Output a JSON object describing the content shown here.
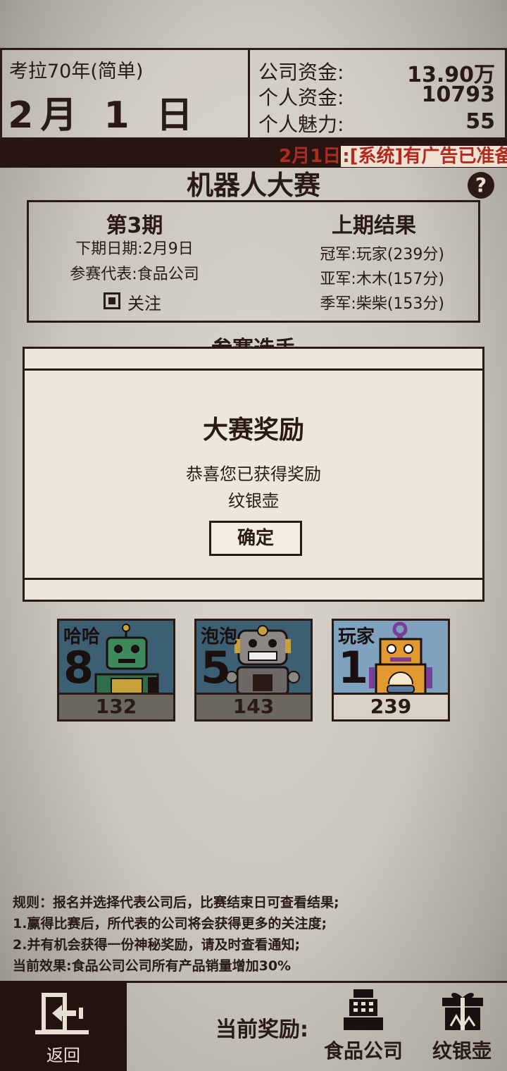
{
  "header": {
    "year_label": "考拉70年(简单)",
    "date": "2月 1 日",
    "funds": [
      {
        "label": "公司资金:",
        "value": "13.90万"
      },
      {
        "label": "个人资金:",
        "value": "10793"
      },
      {
        "label": "个人魅力:",
        "value": "55"
      }
    ]
  },
  "ticker": {
    "date": "2月1日",
    "message": ":[系统]有广告已准备完"
  },
  "page": {
    "title": "机器人大赛",
    "help_icon": "?",
    "section_behind_modal": "参赛选手"
  },
  "info": {
    "issue": "第3期",
    "next_date": "下期日期:2月9日",
    "representative": "参赛代表:食品公司",
    "follow_label": "关注",
    "last_result_title": "上期结果",
    "results": [
      "冠军:玩家(239分)",
      "亚军:木木(157分)",
      "季军:柴柴(153分)"
    ]
  },
  "modal": {
    "title": "大赛奖励",
    "line1": "恭喜您已获得奖励",
    "line2": "纹银壶",
    "ok_button": "确定"
  },
  "competitors": [
    {
      "name": "哈哈",
      "rank": "8",
      "score": "132",
      "bg": "#3d5f74",
      "score_bg": "#6b6660",
      "robot": "green-robot-icon"
    },
    {
      "name": "泡泡",
      "rank": "5",
      "score": "143",
      "bg": "#3d5f74",
      "score_bg": "#6b6660",
      "robot": "grey-robot-icon"
    },
    {
      "name": "玩家",
      "rank": "1",
      "score": "239",
      "bg": "#7fa2be",
      "score_bg": "#d9d2c4",
      "robot": "orange-robot-icon"
    }
  ],
  "rules": [
    "规则：报名并选择代表公司后，比赛结束日可查看结果;",
    "1.赢得比赛后，所代表的公司将会获得更多的关注度;",
    "2.并有机会获得一份神秘奖励，请及时查看通知;",
    "当前效果:食品公司公司所有产品销量增加30%"
  ],
  "bottom": {
    "back_label": "返回",
    "reward_label": "当前奖励:",
    "rewards": [
      {
        "label": "食品公司",
        "icon": "cash-register-icon"
      },
      {
        "label": "纹银壶",
        "icon": "gift-box-icon"
      }
    ]
  },
  "colors": {
    "ink": "#2a1a14",
    "ticker_bg": "#281512",
    "ticker_text": "#b02a22",
    "modal_bg": "#ede6da"
  }
}
